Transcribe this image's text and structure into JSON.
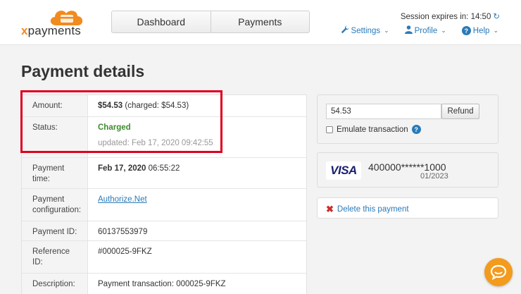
{
  "logo": {
    "text_x": "x",
    "text_rest": "payments",
    "brand_color": "#f28a1e"
  },
  "nav": {
    "tabs": [
      {
        "label": "Dashboard"
      },
      {
        "label": "Payments"
      }
    ]
  },
  "session": {
    "text": "Session expires in: 14:50",
    "icon": "refresh-icon"
  },
  "topmenu": {
    "settings": {
      "label": "Settings",
      "icon": "wrench-icon"
    },
    "profile": {
      "label": "Profile",
      "icon": "user-icon"
    },
    "help": {
      "label": "Help",
      "icon": "question-circle-icon"
    }
  },
  "page": {
    "title": "Payment details"
  },
  "details": {
    "amount": {
      "label": "Amount:",
      "value": "$54.53",
      "charged": "(charged: $54.53)"
    },
    "status": {
      "label": "Status:",
      "value": "Charged",
      "updated": "updated: Feb 17, 2020 09:42:55",
      "color": "#3c8c2d"
    },
    "payment_time": {
      "label": "Payment time:",
      "date": "Feb 17, 2020",
      "time": "06:55:22"
    },
    "payment_config": {
      "label": "Payment configuration:",
      "value": "Authorize.Net"
    },
    "payment_id": {
      "label": "Payment ID:",
      "value": "60137553979"
    },
    "reference_id": {
      "label": "Reference ID:",
      "value": "#000025-9FKZ"
    },
    "description": {
      "label": "Description:",
      "value": "Payment transaction: 000025-9FKZ"
    }
  },
  "refund": {
    "amount": "54.53",
    "button": "Refund",
    "emulate_label": "Emulate transaction"
  },
  "card": {
    "brand": "VISA",
    "number": "400000******1000",
    "expiry": "01/2023"
  },
  "delete": {
    "label": "Delete this payment"
  },
  "colors": {
    "accent": "#2a7ab8",
    "highlight": "#e0001b",
    "chat": "#f29b1c"
  }
}
